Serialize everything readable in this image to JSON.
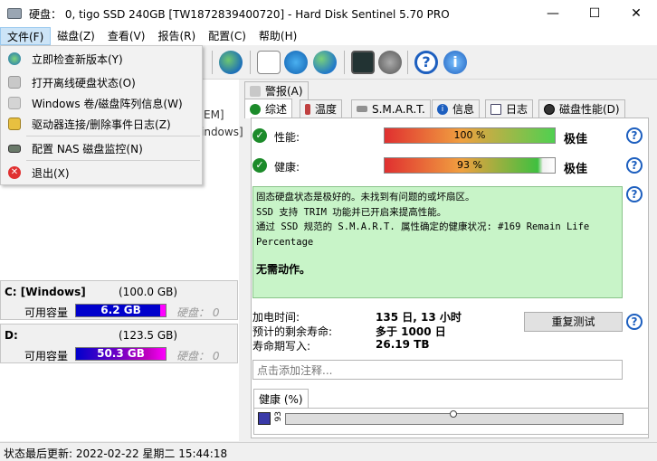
{
  "window": {
    "title": "硬盘： 0, tigo SSD 240GB [TW1872839400720] - Hard Disk Sentinel 5.70 PRO",
    "min": "—",
    "max": "☐",
    "close": "✕"
  },
  "menu": [
    "文件(F)",
    "磁盘(Z)",
    "查看(V)",
    "报告(R)",
    "配置(C)",
    "帮助(H)"
  ],
  "file_menu": [
    "立即检查新版本(Y)",
    "打开离线硬盘状态(O)",
    "Windows 卷/磁盘阵列信息(W)",
    "驱动器连接/删除事件日志(Z)",
    "配置 NAS 磁盘监控(N)",
    "退出(X)"
  ],
  "disk_list_partial": [
    "EM]",
    "indows]"
  ],
  "volumes": [
    {
      "name": "C: [Windows]",
      "size": "(100.0 GB)",
      "free_label": "可用容量",
      "free": "6.2 GB",
      "health_label": "硬盘： 0"
    },
    {
      "name": "D:",
      "size": "(123.5 GB)",
      "free_label": "可用容量",
      "free": "50.3 GB",
      "health_label": "硬盘： 0"
    }
  ],
  "tabs_top": [
    "警报(A)"
  ],
  "tabs": [
    "综述",
    "温度",
    "S.M.A.R.T.",
    "信息",
    "日志",
    "磁盘性能(D)"
  ],
  "performance": {
    "label": "性能:",
    "value_text": "100 %",
    "value": 100,
    "grade": "极佳"
  },
  "health": {
    "label": "健康:",
    "value_text": "93 %",
    "value": 93,
    "grade": "极佳"
  },
  "status_text": {
    "line1": "固态硬盘状态是极好的。未找到有问题的或坏扇区。",
    "line2": "SSD 支持 TRIM 功能并已开启来提高性能。",
    "line3": "通过 SSD 规范的 S.M.A.R.T. 属性确定的健康状况:   #169 Remain Life Percentage",
    "no_action": "无需动作。"
  },
  "info": {
    "power_on_label": "加电时间:",
    "power_on": "135 日, 13 小时",
    "lifetime_label": "预计的剩余寿命:",
    "lifetime": "多于 1000 日",
    "written_label": "寿命期写入:",
    "written": "26.19 TB"
  },
  "retest_button": "重复测试",
  "notes_placeholder": "点击添加注释...",
  "health_chart_tab": "健康 (%)",
  "health_chart_ylabel": "93",
  "statusbar": "状态最后更新:  2022-02-22 星期二 15:44:18",
  "colors": {
    "accent": "#1d5fbf",
    "good": "#1c8b2a",
    "status_bg": "#c8f4c8",
    "free_bar": "#0000cc"
  }
}
